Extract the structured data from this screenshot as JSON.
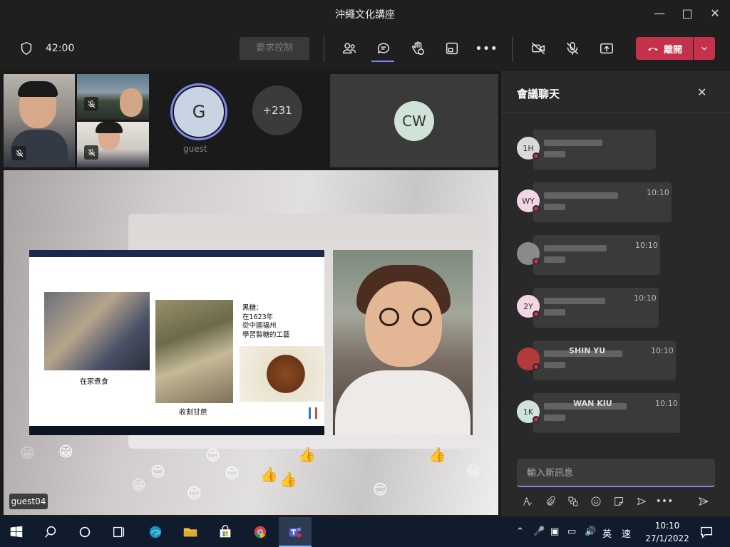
{
  "window": {
    "title": "沖繩文化講座"
  },
  "toolbar": {
    "timer": "42:00",
    "request_control": "要求控制",
    "leave_label": "離開"
  },
  "participants": {
    "guest_name": "guest",
    "avatar_initial": "G",
    "more_count": "+231",
    "cw_initials": "CW",
    "speaker_name": "guest04"
  },
  "slide": {
    "caption1": "在家煮食",
    "caption2": "收割甘蔗",
    "text_lines": [
      "黑糖：",
      "在1623年",
      "從中國福州",
      "學習製糖的工藝"
    ]
  },
  "chat": {
    "title": "會議聊天",
    "messages": [
      {
        "initials": "1H",
        "name": "",
        "time": "",
        "avatar_color": "#d9d9d9"
      },
      {
        "initials": "WY",
        "name": "",
        "time": "10:10",
        "avatar_color": "#f3d6e6"
      },
      {
        "initials": "",
        "name": "",
        "time": "10:10",
        "avatar_color": "#8a8a8a"
      },
      {
        "initials": "2Y",
        "name": "",
        "time": "10:10",
        "avatar_color": "#f3d6e6"
      },
      {
        "initials": "",
        "name": "SHIN YU",
        "time": "10:10",
        "avatar_color": "#b33a3a"
      },
      {
        "initials": "1K",
        "name": "WAN KIU",
        "time": "10:10",
        "avatar_color": "#cfe3d9"
      }
    ],
    "input_placeholder": "輸入新訊息"
  },
  "taskbar": {
    "time": "10:10",
    "date": "27/1/2022",
    "ime_lang": "英",
    "ime_mode": "速"
  },
  "colors": {
    "accent": "#7f85f5",
    "leave": "#c4314b",
    "bg": "#1f1f1f",
    "chat_bg": "#292929",
    "taskbar": "#101b2e"
  }
}
